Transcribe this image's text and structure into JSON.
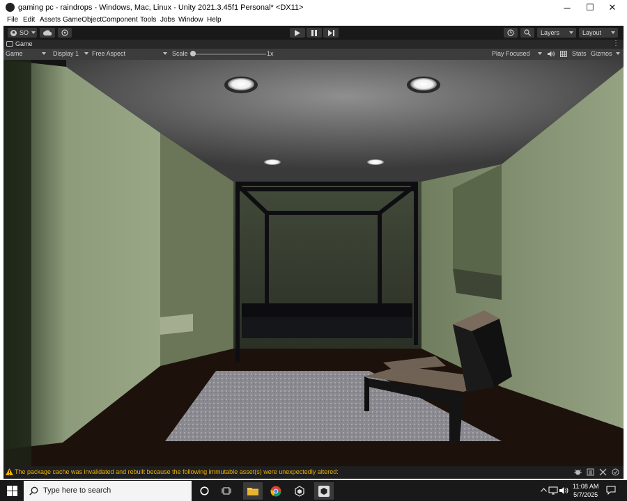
{
  "window": {
    "title": "gaming pc - raindrops - Windows, Mac, Linux - Unity 2021.3.45f1 Personal* <DX11>",
    "minimize_glyph": "─",
    "maximize_glyph": "☐",
    "close_glyph": "✕"
  },
  "menu": [
    "File",
    "Edit",
    "Assets",
    "GameObject",
    "Component",
    "Tools",
    "Jobs",
    "Window",
    "Help"
  ],
  "toolbar": {
    "account_label": "SO",
    "layers_label": "Layers",
    "layout_label": "Layout"
  },
  "game_tab": {
    "label": "Game"
  },
  "game_bar": {
    "view_select": "Game",
    "display_select": "Display 1",
    "aspect_select": "Free Aspect",
    "scale_label": "Scale",
    "scale_value": "1x",
    "play_mode": "Play Focused",
    "stats_label": "Stats",
    "gizmos_label": "Gizmos"
  },
  "status": {
    "message": "The package cache was invalidated and rebuilt because the following immutable asset(s) were unexpectedly altered:"
  },
  "taskbar": {
    "search_placeholder": "Type here to search",
    "time": "11:08 AM",
    "date": "5/7/2025"
  },
  "colors": {
    "warning": "#f0b000",
    "unity_dark": "#191919",
    "wall_green": "#8a9a76"
  }
}
